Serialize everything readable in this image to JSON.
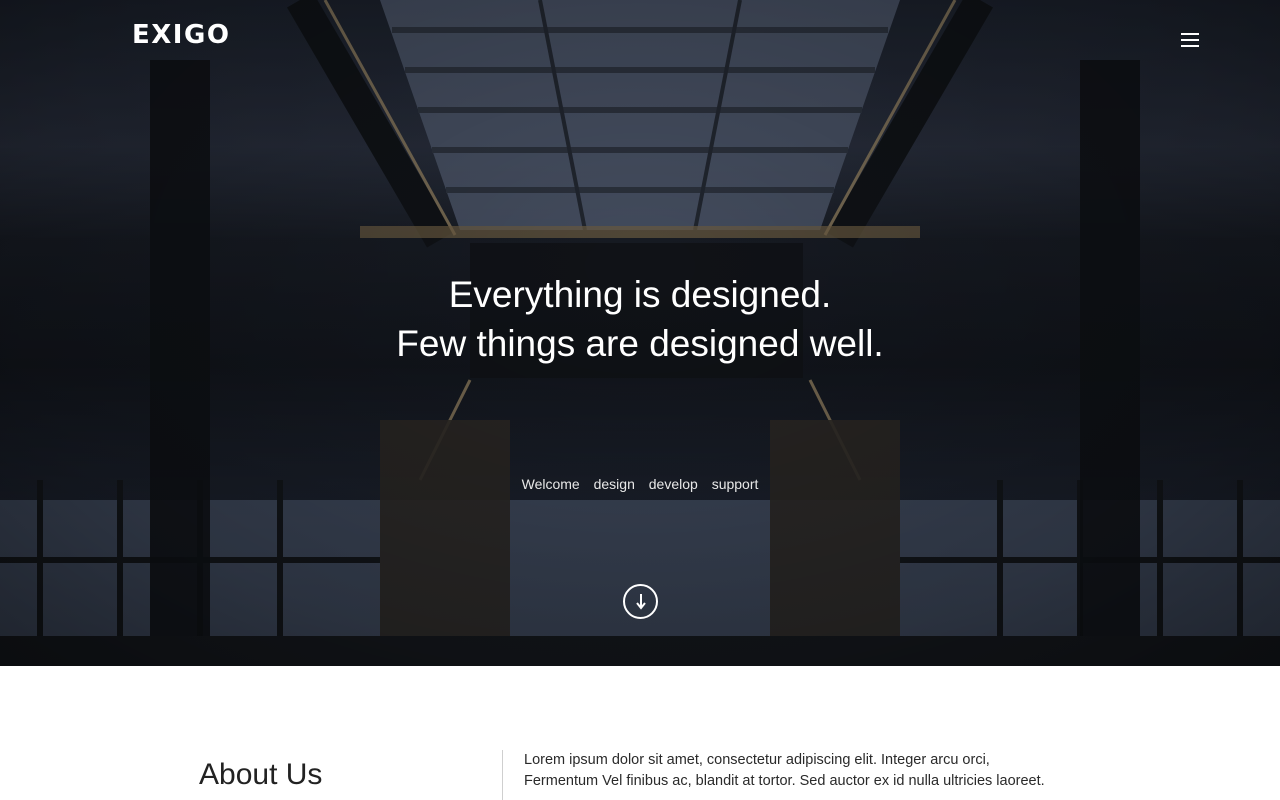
{
  "header": {
    "logo": "EXIGO",
    "menu_icon": "hamburger-menu-icon"
  },
  "hero": {
    "tagline_line1": "Everything is designed.",
    "tagline_line2": "Few things are designed well.",
    "links": [
      "Welcome",
      "design",
      "develop",
      "support"
    ],
    "scroll_icon": "arrow-down-circle-icon"
  },
  "about": {
    "title": "About Us",
    "text_line1": "Lorem ipsum dolor sit amet, consectetur adipiscing elit. Integer arcu orci,",
    "text_line2": "Fermentum Vel finibus ac, blandit at tortor. Sed auctor ex id nulla ultricies laoreet."
  },
  "colors": {
    "hero_dark": "#1d2129",
    "text_white": "#ffffff",
    "body_text": "#2a2a2a"
  }
}
